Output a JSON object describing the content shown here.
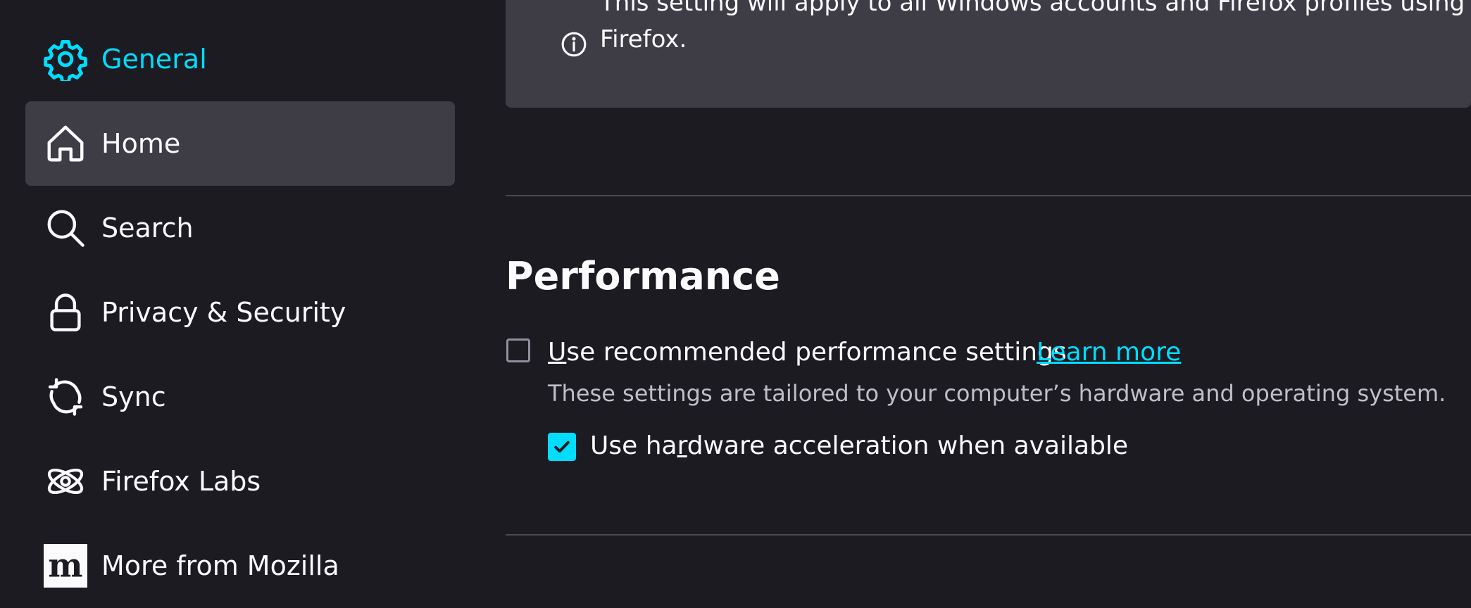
{
  "sidebar": {
    "items": [
      {
        "label": "General",
        "icon": "gear-icon"
      },
      {
        "label": "Home",
        "icon": "home-icon"
      },
      {
        "label": "Search",
        "icon": "search-icon"
      },
      {
        "label": "Privacy & Security",
        "icon": "lock-icon"
      },
      {
        "label": "Sync",
        "icon": "sync-icon"
      },
      {
        "label": "Firefox Labs",
        "icon": "atom-icon"
      },
      {
        "label": "More from Mozilla",
        "icon": "mozilla-logo-icon"
      }
    ]
  },
  "info_box": {
    "line1": "This setting will apply to all Windows accounts and Firefox profiles using this installation of Firefox.",
    "line2": "Firefox."
  },
  "performance": {
    "title": "Performance",
    "recommended": {
      "label_prefix": "",
      "label_accesskey": "U",
      "label_rest": "se recommended performance settings",
      "checked": false,
      "learn_more": "Learn more",
      "description": "These settings are tailored to your computer’s hardware and operating system."
    },
    "hw_accel": {
      "label_prefix": "Use ha",
      "label_accesskey": "r",
      "label_rest": "dware acceleration when available",
      "checked": true
    }
  },
  "colors": {
    "accent": "#00ddff",
    "background": "#1c1b22",
    "selected_item": "#3e3d45"
  }
}
